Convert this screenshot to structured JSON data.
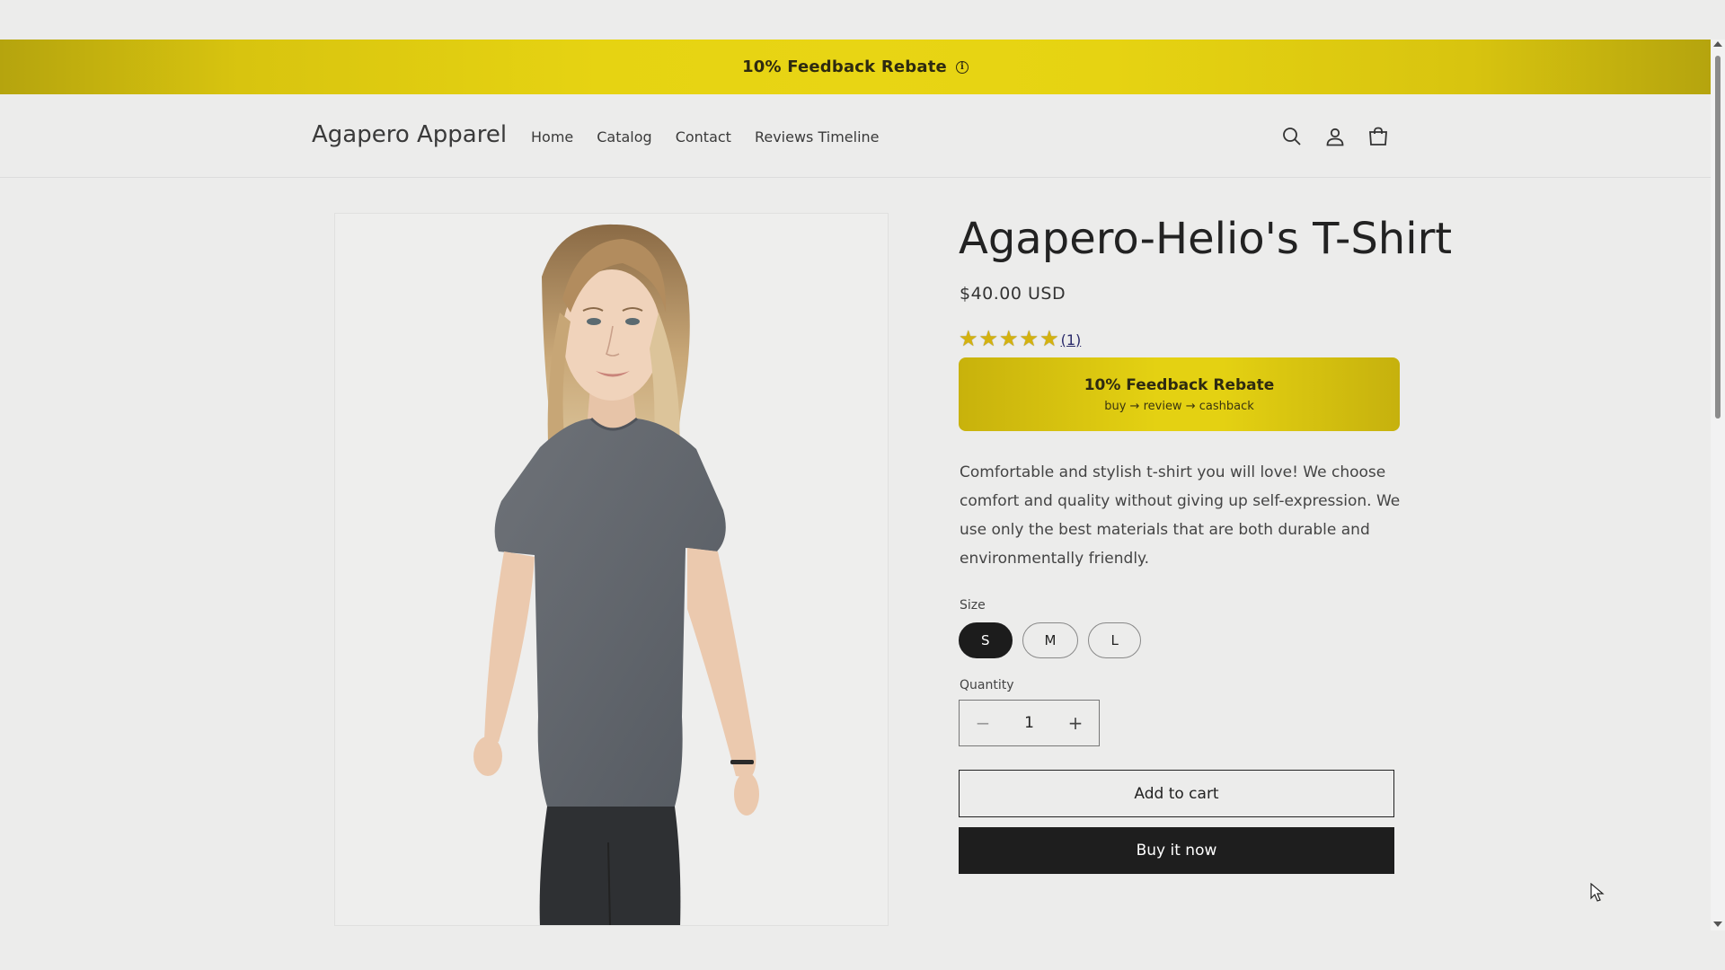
{
  "announcement": {
    "text": "10% Feedback Rebate",
    "info_icon": "info-icon"
  },
  "header": {
    "logo": "Agapero Apparel",
    "nav": [
      "Home",
      "Catalog",
      "Contact",
      "Reviews Timeline"
    ],
    "icons": [
      "search-icon",
      "account-icon",
      "cart-icon"
    ]
  },
  "product": {
    "title": "Agapero-Helio's T-Shirt",
    "price": "$40.00 USD",
    "rating": {
      "stars": 5,
      "count_label": "(1)"
    },
    "rebate": {
      "title": "10% Feedback Rebate",
      "subtitle": "buy → review → cashback"
    },
    "description": "Comfortable and stylish t-shirt you will love! We choose comfort and quality without giving up self-expression. We use only the best materials that are both durable and environmentally friendly.",
    "size_label": "Size",
    "sizes": [
      "S",
      "M",
      "L"
    ],
    "selected_size": "S",
    "quantity_label": "Quantity",
    "quantity": "1",
    "add_to_cart": "Add to cart",
    "buy_now": "Buy it now"
  },
  "colors": {
    "accent_yellow": "#e6d312",
    "button_dark": "#1e1e1e",
    "background": "#ececeb"
  }
}
